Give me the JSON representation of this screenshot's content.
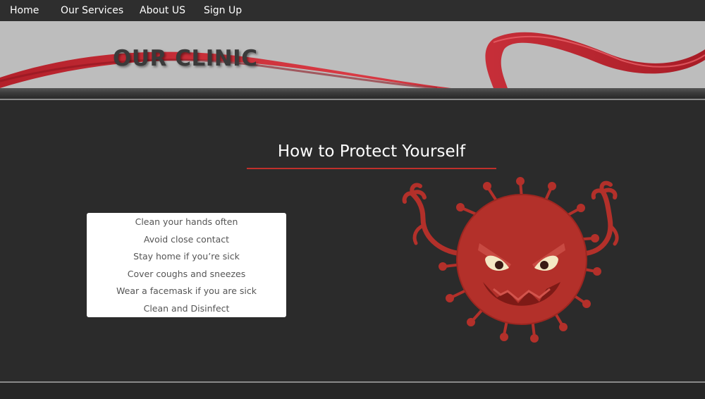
{
  "nav": {
    "items": [
      {
        "label": "Home"
      },
      {
        "label": "Our Services"
      },
      {
        "label": "About US"
      },
      {
        "label": "Sign Up"
      }
    ]
  },
  "banner": {
    "title": "OUR CLINIC"
  },
  "main": {
    "heading": "How to Protect Yourself",
    "tips": [
      "Clean your hands often",
      "Avoid close contact",
      "Stay home if you’re sick",
      "Cover coughs and sneezes",
      "Wear a facemask if you are sick",
      "Clean and Disinfect"
    ]
  },
  "colors": {
    "accent": "#c0302b",
    "background": "#2b2b2b",
    "banner": "#bdbdbd"
  }
}
